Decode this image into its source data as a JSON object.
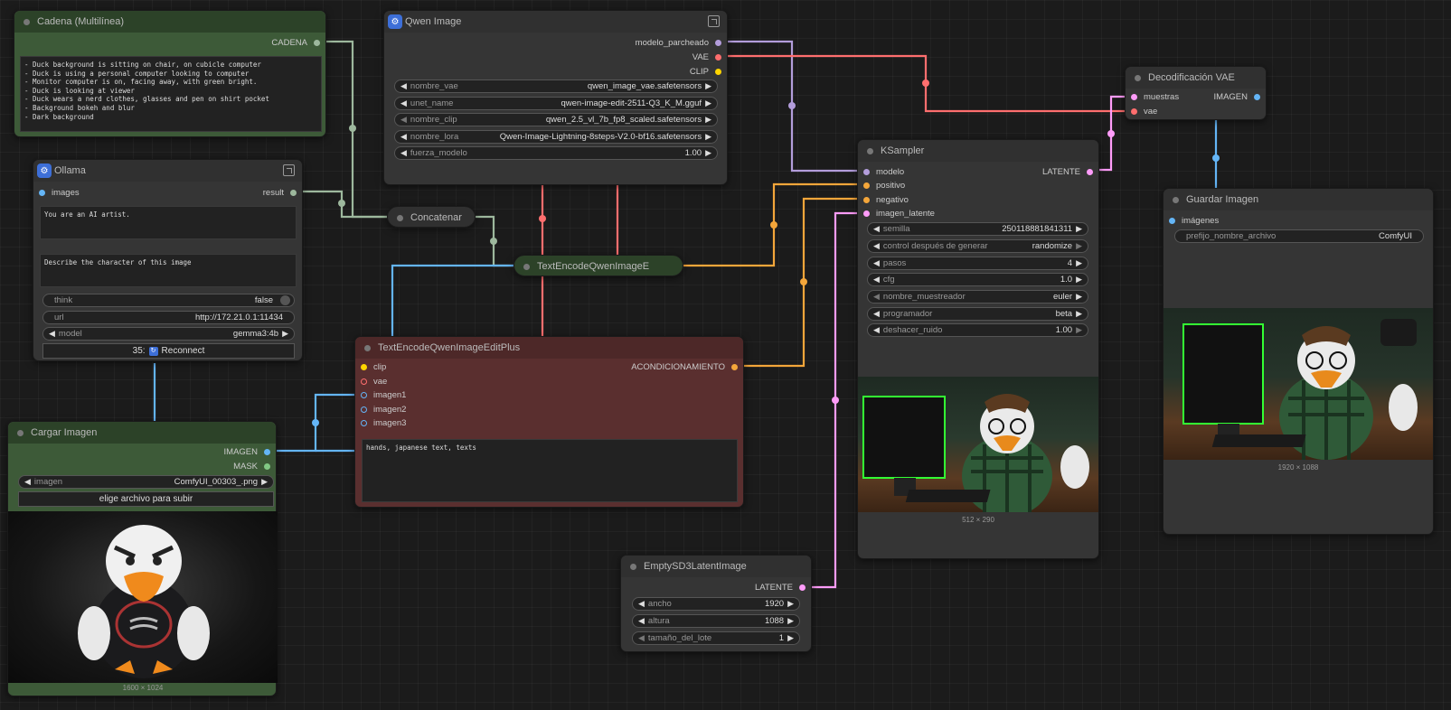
{
  "colors": {
    "conditioning": "#f4a63a",
    "vae": "#ff6e6e",
    "clip": "#ffd500",
    "model": "#b39ddb",
    "latent": "#ff9cf9",
    "image": "#64b5f6",
    "string": "#9db89d",
    "green_node": "#3d5a38",
    "red_node": "#5a2f2f",
    "green_header": "#2c4228",
    "red_header": "#4d2828"
  },
  "nodes": {
    "cadena": {
      "title": "Cadena (Multilínea)",
      "output_label": "CADENA",
      "text": "- Duck background is sitting on chair, on cubicle computer\n- Duck is using a personal computer looking to computer\n- Monitor computer is on, facing away, with green bright.\n- Duck is looking at viewer\n- Duck wears a nerd clothes, glasses and pen on shirt pocket\n- Background bokeh and blur\n- Dark background"
    },
    "ollama": {
      "title": "Ollama",
      "input_label": "images",
      "output_label": "result",
      "system_prompt": "You are an AI artist.",
      "prompt": "Describe the character of this image",
      "think_label": "think",
      "think_value": "false",
      "url_label": "url",
      "url_value": "http://172.21.0.1:11434",
      "model_label": "model",
      "model_value": "gemma3:4b",
      "reconnect_prefix": "35:",
      "reconnect_label": "Reconnect"
    },
    "cargar": {
      "title": "Cargar Imagen",
      "out_image": "IMAGEN",
      "out_mask": "MASK",
      "imagen_label": "imagen",
      "imagen_value": "ComfyUI_00303_.png",
      "upload_label": "elige archivo para subir",
      "caption": "1600 × 1024"
    },
    "qwen": {
      "title": "Qwen Image",
      "out_model": "modelo_parcheado",
      "out_vae": "VAE",
      "out_clip": "CLIP",
      "widgets": [
        {
          "label": "nombre_vae",
          "value": "qwen_image_vae.safetensors"
        },
        {
          "label": "unet_name",
          "value": "qwen-image-edit-2511-Q3_K_M.gguf"
        },
        {
          "label": "nombre_clip",
          "value": "qwen_2.5_vl_7b_fp8_scaled.safetensors"
        },
        {
          "label": "nombre_lora",
          "value": "Qwen-Image-Lightning-8steps-V2.0-bf16.safetensors"
        },
        {
          "label": "fuerza_modelo",
          "value": "1.00"
        }
      ]
    },
    "concat": {
      "title": "Concatenar"
    },
    "tenc": {
      "title": "TextEncodeQwenImageE"
    },
    "plus": {
      "title": "TextEncodeQwenImageEditPlus",
      "inputs": [
        "clip",
        "vae",
        "imagen1",
        "imagen2",
        "imagen3"
      ],
      "output_label": "ACONDICIONAMIENTO",
      "text": "hands, japanese text, texts"
    },
    "ksampler": {
      "title": "KSampler",
      "inputs": [
        "modelo",
        "positivo",
        "negativo",
        "imagen_latente"
      ],
      "output_label": "LATENTE",
      "widgets": [
        {
          "label": "semilla",
          "value": "250118881841311"
        },
        {
          "label": "control después de generar",
          "value": "randomize"
        },
        {
          "label": "pasos",
          "value": "4"
        },
        {
          "label": "cfg",
          "value": "1.0"
        },
        {
          "label": "nombre_muestreador",
          "value": "euler"
        },
        {
          "label": "programador",
          "value": "beta"
        },
        {
          "label": "deshacer_ruido",
          "value": "1.00"
        }
      ],
      "caption": "512 × 290"
    },
    "vaedec": {
      "title": "Decodificación VAE",
      "in_samples": "muestras",
      "in_vae": "vae",
      "output_label": "IMAGEN"
    },
    "guardar": {
      "title": "Guardar Imagen",
      "input_label": "imágenes",
      "prefix_label": "prefijo_nombre_archivo",
      "prefix_value": "ComfyUI",
      "caption": "1920 × 1088"
    },
    "empty": {
      "title": "EmptySD3LatentImage",
      "output_label": "LATENTE",
      "widgets": [
        {
          "label": "ancho",
          "value": "1920"
        },
        {
          "label": "altura",
          "value": "1088"
        },
        {
          "label": "tamaño_del_lote",
          "value": "1"
        }
      ]
    }
  }
}
